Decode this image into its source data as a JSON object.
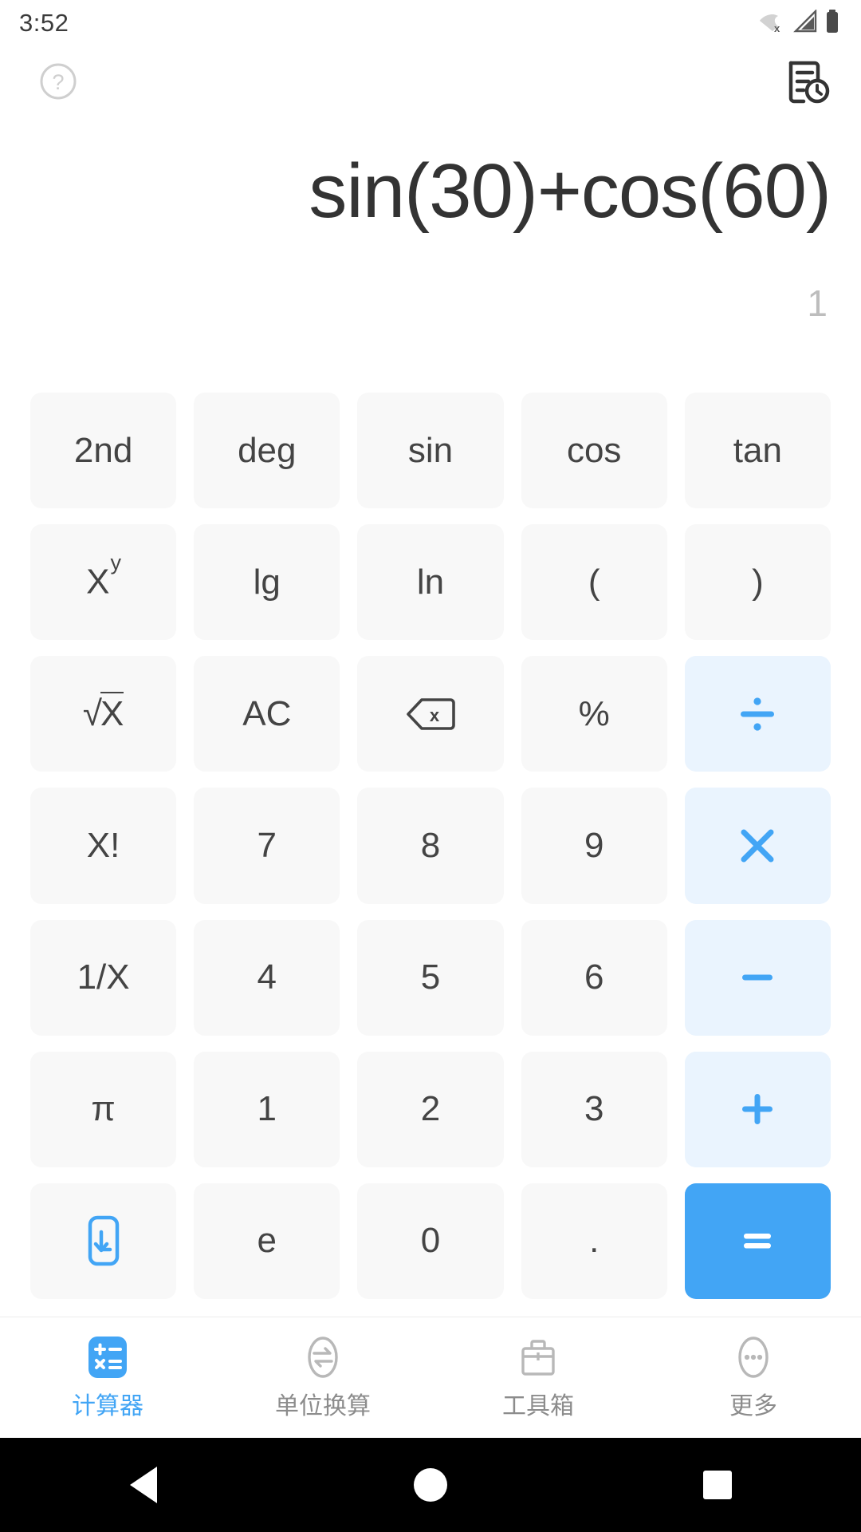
{
  "status_bar": {
    "time": "3:52",
    "icons": [
      {
        "name": "wifi-off-icon",
        "label": "wifi-disabled"
      },
      {
        "name": "cellular-signal-icon",
        "label": "signal"
      },
      {
        "name": "battery-icon",
        "label": "battery-full"
      }
    ]
  },
  "header": {
    "help_icon": "help-circle-icon",
    "history_icon": "history-document-icon"
  },
  "display": {
    "expression": "sin(30)+cos(60)",
    "result": "1"
  },
  "colors": {
    "accent": "#42a5f5",
    "operator_bg": "#eaf4fe",
    "key_bg": "#f8f8f8",
    "key_text": "#444444",
    "expression_text": "#333333",
    "result_text": "#bdbdbd",
    "nav_inactive": "#8c8c8c"
  },
  "keypad": {
    "rows": [
      [
        {
          "label": "2nd",
          "name": "key-second-function",
          "style": "func"
        },
        {
          "label": "deg",
          "name": "key-degree-mode",
          "style": "func"
        },
        {
          "label": "sin",
          "name": "key-sin",
          "style": "func"
        },
        {
          "label": "cos",
          "name": "key-cos",
          "style": "func"
        },
        {
          "label": "tan",
          "name": "key-tan",
          "style": "func"
        }
      ],
      [
        {
          "label": "X",
          "sup": "y",
          "name": "key-power",
          "style": "func"
        },
        {
          "label": "lg",
          "name": "key-log10",
          "style": "func"
        },
        {
          "label": "ln",
          "name": "key-natural-log",
          "style": "func"
        },
        {
          "label": "(",
          "name": "key-open-paren",
          "style": "func"
        },
        {
          "label": ")",
          "name": "key-close-paren",
          "style": "func"
        }
      ],
      [
        {
          "label": "√X",
          "name": "key-square-root",
          "style": "sqrt"
        },
        {
          "label": "AC",
          "name": "key-all-clear",
          "style": "func"
        },
        {
          "label": "",
          "name": "key-backspace",
          "style": "icon",
          "icon": "backspace-icon"
        },
        {
          "label": "%",
          "name": "key-percent",
          "style": "func"
        },
        {
          "label": "÷",
          "name": "key-divide",
          "style": "op",
          "icon": "divide-icon"
        }
      ],
      [
        {
          "label": "X!",
          "name": "key-factorial",
          "style": "func"
        },
        {
          "label": "7",
          "name": "key-7",
          "style": "num"
        },
        {
          "label": "8",
          "name": "key-8",
          "style": "num"
        },
        {
          "label": "9",
          "name": "key-9",
          "style": "num"
        },
        {
          "label": "×",
          "name": "key-multiply",
          "style": "op",
          "icon": "multiply-icon"
        }
      ],
      [
        {
          "label": "1/X",
          "name": "key-reciprocal",
          "style": "func"
        },
        {
          "label": "4",
          "name": "key-4",
          "style": "num"
        },
        {
          "label": "5",
          "name": "key-5",
          "style": "num"
        },
        {
          "label": "6",
          "name": "key-6",
          "style": "num"
        },
        {
          "label": "−",
          "name": "key-subtract",
          "style": "op",
          "icon": "minus-icon"
        }
      ],
      [
        {
          "label": "π",
          "name": "key-pi",
          "style": "func"
        },
        {
          "label": "1",
          "name": "key-1",
          "style": "num"
        },
        {
          "label": "2",
          "name": "key-2",
          "style": "num"
        },
        {
          "label": "3",
          "name": "key-3",
          "style": "num"
        },
        {
          "label": "+",
          "name": "key-add",
          "style": "op",
          "icon": "plus-icon"
        }
      ],
      [
        {
          "label": "",
          "name": "key-collapse-keypad",
          "style": "icon",
          "icon": "arrow-down-right-box-icon"
        },
        {
          "label": "e",
          "name": "key-euler",
          "style": "func"
        },
        {
          "label": "0",
          "name": "key-0",
          "style": "num"
        },
        {
          "label": ".",
          "name": "key-decimal-point",
          "style": "num"
        },
        {
          "label": "=",
          "name": "key-equals",
          "style": "equals",
          "icon": "equals-icon"
        }
      ]
    ]
  },
  "bottom_nav": {
    "items": [
      {
        "label": "计算器",
        "name": "nav-calculator",
        "icon": "calculator-icon",
        "active": true
      },
      {
        "label": "单位换算",
        "name": "nav-unit-conversion",
        "icon": "unit-convert-icon",
        "active": false
      },
      {
        "label": "工具箱",
        "name": "nav-toolbox",
        "icon": "toolbox-icon",
        "active": false
      },
      {
        "label": "更多",
        "name": "nav-more",
        "icon": "more-ellipsis-icon",
        "active": false
      }
    ]
  },
  "system_nav": {
    "back": "back-triangle-icon",
    "home": "home-circle-icon",
    "recents": "recents-square-icon"
  }
}
